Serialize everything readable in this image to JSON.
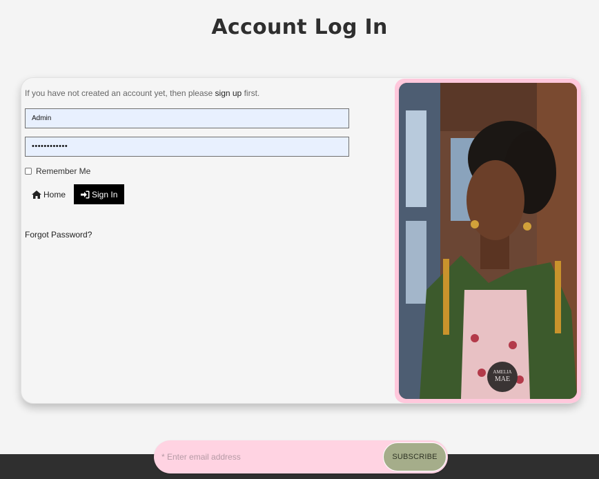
{
  "page": {
    "title": "Account Log In"
  },
  "login_form": {
    "hint_before": "If you have not created an account yet, then please ",
    "hint_link": "sign up",
    "hint_after": " first.",
    "username_value": "Admin",
    "password_value": "••••••••••••",
    "remember_label": "Remember Me",
    "home_label": "Home",
    "signin_label": "Sign In",
    "forgot_label": "Forgot Password?"
  },
  "photo": {
    "badge_line1": "AMELIA",
    "badge_line2": "MAE"
  },
  "newsletter": {
    "placeholder": "* Enter email address",
    "button_label": "SUBSCRIBE"
  },
  "colors": {
    "accent_pink": "#ffc8dc",
    "subscribe_green": "#a5ad8a",
    "signin_black": "#000000",
    "footer_dark": "#2f2f2f",
    "field_blue": "#e8f0fe"
  },
  "icons": {
    "home": "home-icon",
    "signin": "sign-in-icon"
  }
}
